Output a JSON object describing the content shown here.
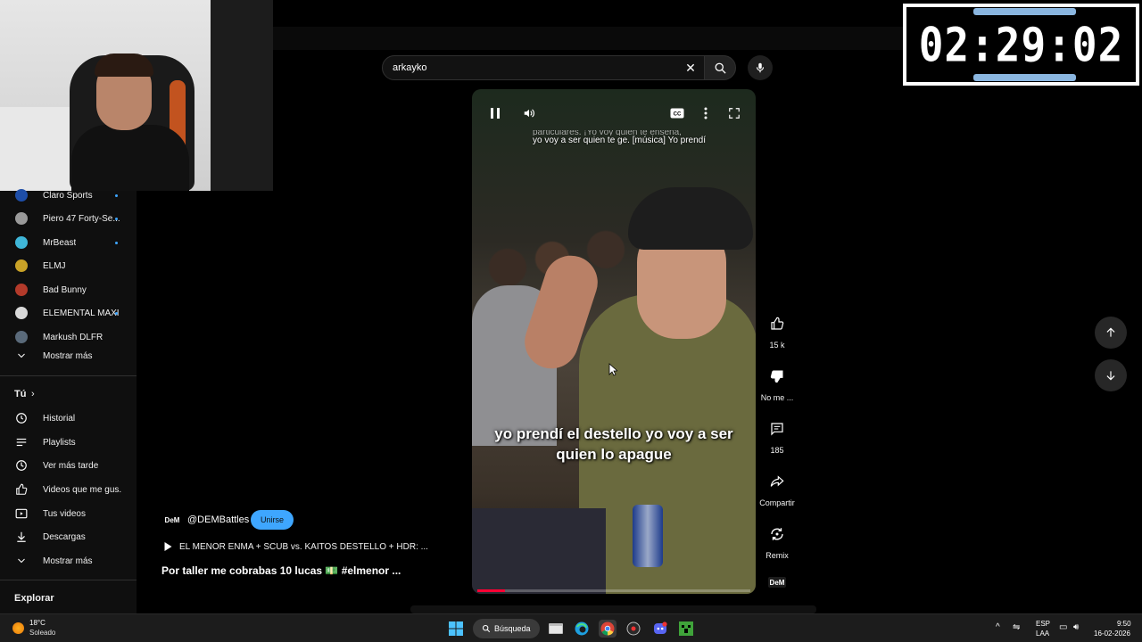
{
  "timer": {
    "value": "02:29:02"
  },
  "search": {
    "query": "arkayko"
  },
  "sidebar": {
    "subscriptions": [
      {
        "label": "Claro Sports",
        "avatar_color": "#1e4ea8",
        "new": true
      },
      {
        "label": "Piero 47 Forty-Se...",
        "avatar_color": "#9a9a9a",
        "new": true
      },
      {
        "label": "MrBeast",
        "avatar_color": "#3fb6d8",
        "new": true
      },
      {
        "label": "ELMJ",
        "avatar_color": "#c9a227",
        "new": false
      },
      {
        "label": "Bad Bunny",
        "avatar_color": "#b33a2a",
        "new": false
      },
      {
        "label": "ELEMENTAL MAXI",
        "avatar_color": "#d9d9d9",
        "new": true
      },
      {
        "label": "Markush DLFR",
        "avatar_color": "#5a6a7a",
        "new": false
      }
    ],
    "show_more_subs": "Mostrar más",
    "you_header": "Tú",
    "you_items": [
      {
        "label": "Historial",
        "icon": "history-icon"
      },
      {
        "label": "Playlists",
        "icon": "playlists-icon"
      },
      {
        "label": "Ver más tarde",
        "icon": "watch-later-icon"
      },
      {
        "label": "Videos que me gus...",
        "icon": "liked-icon"
      },
      {
        "label": "Tus videos",
        "icon": "your-videos-icon"
      },
      {
        "label": "Descargas",
        "icon": "download-icon"
      }
    ],
    "show_more_you": "Mostrar más",
    "explore_header": "Explorar"
  },
  "video": {
    "caption_top": "yo voy a ser quien te ge. [música] Yo prendí",
    "caption_top_cut": "particulares. ¡Yo voy quien te enseña,",
    "subtitle": "yo prendí el destello yo voy a ser quien lo apague",
    "progress": 0.1
  },
  "actions": {
    "likes": "15 k",
    "dislike": "No me ...",
    "comments": "185",
    "share": "Compartir",
    "remix": "Remix",
    "channel_logo": "DeM"
  },
  "channel": {
    "logo": "DeM",
    "handle": "@DEMBattles",
    "join": "Unirse",
    "playlist_title": "EL MENOR ENMA + SCUB vs. KAITOS DESTELLO + HDR: ...",
    "video_title": "Por taller me cobrabas 10 lucas 💵 #elmenor ..."
  },
  "taskbar": {
    "temperature": "18°C",
    "condition": "Soleado",
    "search_label": "Búsqueda",
    "lang_top": "ESP",
    "lang_bottom": "LAA",
    "time": "9:50",
    "date": "16-02-2026"
  },
  "colors": {
    "accent": "#3ea6ff",
    "progress": "#ff0033",
    "background": "#0f0f0f"
  }
}
